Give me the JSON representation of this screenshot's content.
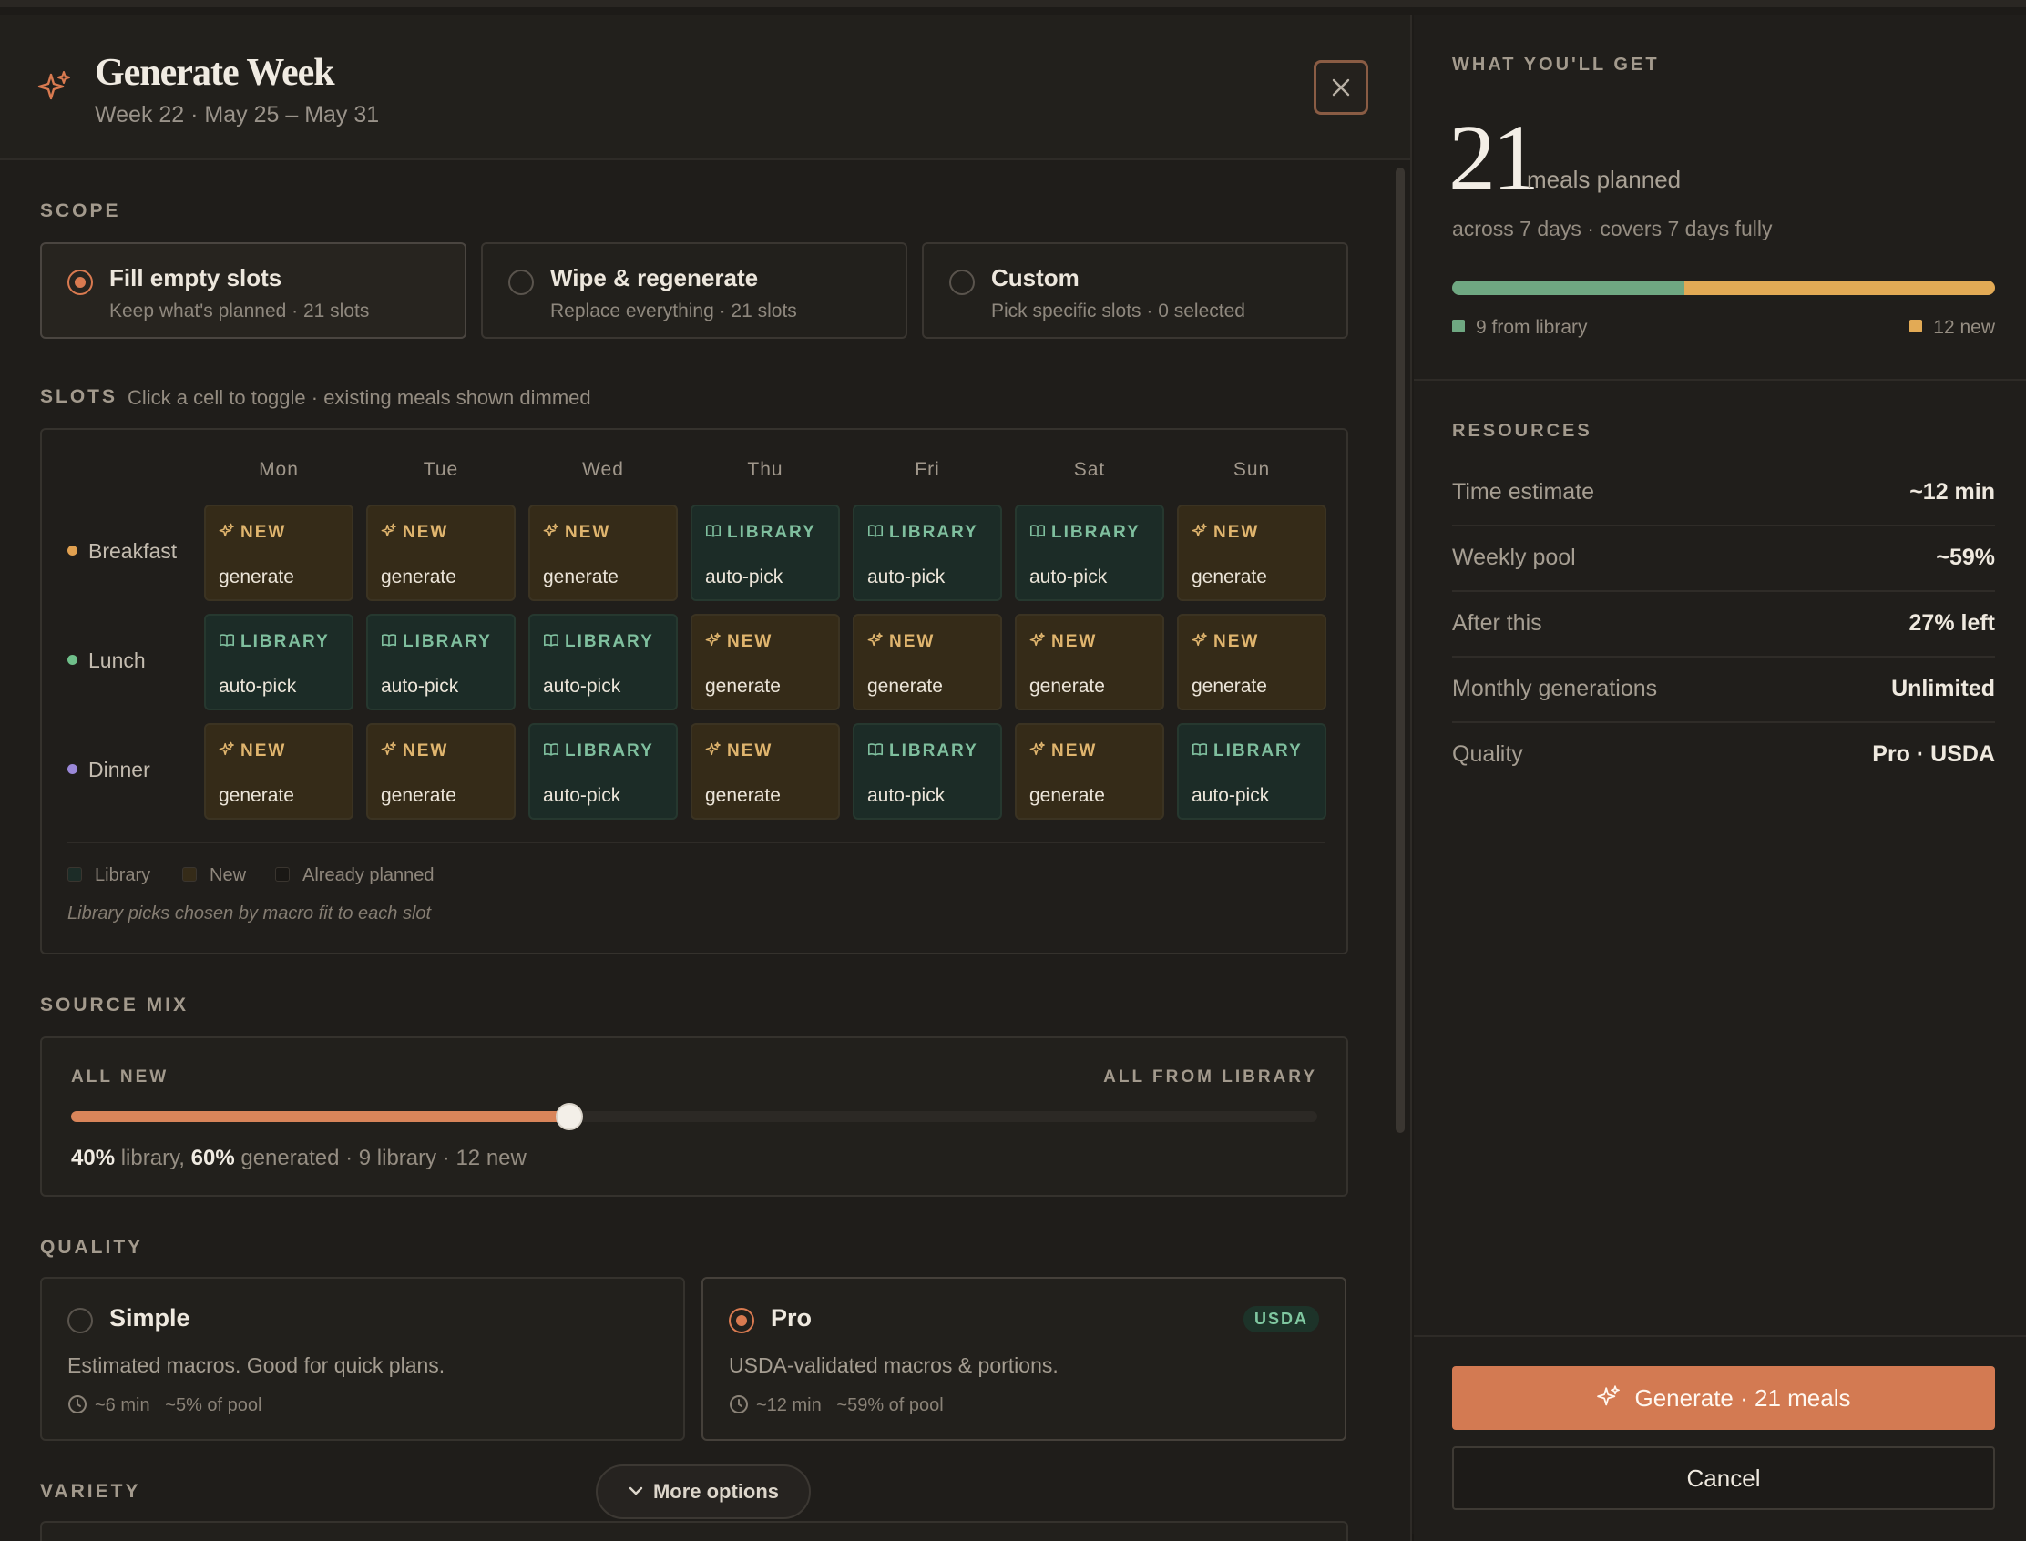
{
  "header": {
    "title": "Generate Week",
    "subtitle": "Week 22 · May 25 – May 31"
  },
  "scope": {
    "label": "SCOPE",
    "options": [
      {
        "title": "Fill empty slots",
        "desc": "Keep what's planned · 21 slots",
        "selected": true
      },
      {
        "title": "Wipe & regenerate",
        "desc": "Replace everything · 21 slots",
        "selected": false
      },
      {
        "title": "Custom",
        "desc": "Pick specific slots · 0 selected",
        "selected": false
      }
    ]
  },
  "slots": {
    "label": "SLOTS",
    "hint": "Click a cell to toggle · existing meals shown dimmed",
    "days": [
      "Mon",
      "Tue",
      "Wed",
      "Thu",
      "Fri",
      "Sat",
      "Sun"
    ],
    "rows": [
      {
        "label": "Breakfast",
        "dot_color": "#e0a050",
        "cells": [
          "new",
          "new",
          "new",
          "lib",
          "lib",
          "lib",
          "new"
        ]
      },
      {
        "label": "Lunch",
        "dot_color": "#6fbf8a",
        "cells": [
          "lib",
          "lib",
          "lib",
          "new",
          "new",
          "new",
          "new"
        ]
      },
      {
        "label": "Dinner",
        "dot_color": "#9a88d8",
        "cells": [
          "new",
          "new",
          "lib",
          "new",
          "lib",
          "new",
          "lib"
        ]
      }
    ],
    "cell_types": {
      "new": {
        "tag": "NEW",
        "action": "generate"
      },
      "lib": {
        "tag": "LIBRARY",
        "action": "auto-pick"
      }
    },
    "legend": {
      "library": "Library",
      "new": "New",
      "planned": "Already planned"
    },
    "note": "Library picks chosen by macro fit to each slot"
  },
  "source_mix": {
    "label": "SOURCE MIX",
    "left_label": "ALL NEW",
    "right_label": "ALL FROM LIBRARY",
    "slider_value": 0.4,
    "library_pct": "40%",
    "library_word": "library,",
    "generated_pct": "60%",
    "generated_tail": "generated · 9 library · 12 new"
  },
  "quality": {
    "label": "QUALITY",
    "options": [
      {
        "title": "Simple",
        "desc": "Estimated macros. Good for quick plans.",
        "time": "~6 min",
        "pool": "~5% of pool",
        "selected": false
      },
      {
        "title": "Pro",
        "desc": "USDA-validated macros & portions.",
        "time": "~12 min",
        "pool": "~59% of pool",
        "selected": true,
        "badge": "USDA"
      }
    ]
  },
  "variety": {
    "label": "VARIETY"
  },
  "more_options": "More options",
  "summary": {
    "label": "WHAT YOU'LL GET",
    "count": "21",
    "unit": "meals planned",
    "across": "across 7 days · covers 7 days fully",
    "library_count": 9,
    "new_count": 12,
    "library_text": "9 from library",
    "new_text": "12 new",
    "library_color": "#6fa882",
    "new_color": "#e2aa55"
  },
  "resources": {
    "label": "RESOURCES",
    "rows": [
      {
        "k": "Time estimate",
        "v": "~12 min"
      },
      {
        "k": "Weekly pool",
        "v": "~59%"
      },
      {
        "k": "After this",
        "v": "27% left"
      },
      {
        "k": "Monthly generations",
        "v": "Unlimited"
      },
      {
        "k": "Quality",
        "v": "Pro · USDA"
      }
    ]
  },
  "actions": {
    "generate": "Generate · 21 meals",
    "cancel": "Cancel"
  },
  "colors": {
    "accent": "#d37a52"
  }
}
